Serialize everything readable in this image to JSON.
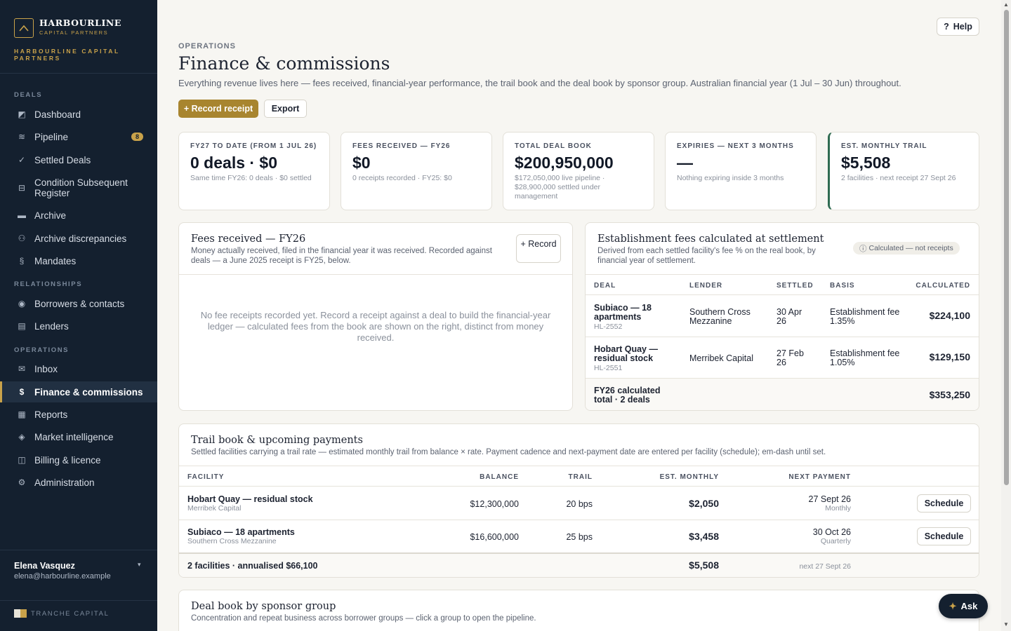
{
  "brand": {
    "name": "HARBOURLINE",
    "sub": "CAPITAL PARTNERS",
    "long": "HARBOURLINE CAPITAL PARTNERS"
  },
  "sidebar": {
    "sections": [
      {
        "label": "DEALS"
      },
      {
        "label": "RELATIONSHIPS"
      },
      {
        "label": "OPERATIONS"
      }
    ],
    "items": [
      {
        "label": "Dashboard",
        "icon": "dashboard-icon"
      },
      {
        "label": "Pipeline",
        "icon": "pipeline-icon",
        "badge": "8"
      },
      {
        "label": "Settled Deals",
        "icon": "check-icon"
      },
      {
        "label": "Condition Subsequent Register",
        "icon": "register-icon"
      },
      {
        "label": "Archive",
        "icon": "archive-icon"
      },
      {
        "label": "Archive discrepancies",
        "icon": "discrepancies-icon"
      },
      {
        "label": "Mandates",
        "icon": "mandates-icon"
      },
      {
        "label": "Borrowers & contacts",
        "icon": "contacts-icon"
      },
      {
        "label": "Lenders",
        "icon": "lenders-icon"
      },
      {
        "label": "Inbox",
        "icon": "inbox-icon"
      },
      {
        "label": "Finance & commissions",
        "icon": "dollar-icon"
      },
      {
        "label": "Reports",
        "icon": "reports-icon"
      },
      {
        "label": "Market intelligence",
        "icon": "market-icon"
      },
      {
        "label": "Billing & licence",
        "icon": "billing-icon"
      },
      {
        "label": "Administration",
        "icon": "gear-icon"
      }
    ],
    "user": {
      "name": "Elena Vasquez",
      "email": "elena@harbourline.example"
    },
    "footer": "TRANCHE CAPITAL"
  },
  "header": {
    "help": "Help",
    "eyebrow": "OPERATIONS",
    "title": "Finance & commissions",
    "subtitle": "Everything revenue lives here — fees received, financial-year performance, the trail book and the deal book by sponsor group. Australian financial year (1 Jul – 30 Jun) throughout.",
    "primary_btn": "+ Record receipt",
    "secondary_btn": "Export"
  },
  "kpis": [
    {
      "label": "FY27 TO DATE (FROM 1 JUL 26)",
      "value": "0 deals · $0",
      "note": "Same time FY26: 0 deals · $0 settled"
    },
    {
      "label": "FEES RECEIVED — FY26",
      "value": "$0",
      "note": "0 receipts recorded · FY25: $0"
    },
    {
      "label": "TOTAL DEAL BOOK",
      "value": "$200,950,000",
      "note": "$172,050,000 live pipeline · $28,900,000 settled under management"
    },
    {
      "label": "EXPIRIES — NEXT 3 MONTHS",
      "value": "—",
      "note": "Nothing expiring inside 3 months"
    },
    {
      "label": "EST. MONTHLY TRAIL",
      "value": "$5,508",
      "note": "2 facilities · next receipt 27 Sept 26"
    }
  ],
  "fees": {
    "title": "Fees received — FY26",
    "desc": "Money actually received, filed in the financial year it was received. Recorded against deals — a June 2025 receipt is FY25, below.",
    "record_btn": "+ Record",
    "empty": "No fee receipts recorded yet. Record a receipt against a deal to build the financial-year ledger — calculated fees from the book are shown on the right, distinct from money received."
  },
  "establishment": {
    "title": "Establishment fees calculated at settlement",
    "desc": "Derived from each settled facility's fee % on the real book, by financial year of settlement.",
    "chip": "Calculated — not receipts",
    "columns": [
      "DEAL",
      "LENDER",
      "SETTLED",
      "BASIS",
      "CALCULATED"
    ],
    "rows": [
      {
        "deal": "Subiaco — 18 apartments",
        "code": "HL-2552",
        "lender": "Southern Cross Mezzanine",
        "settled": "30 Apr 26",
        "basis": "Establishment fee 1.35%",
        "calculated": "$224,100"
      },
      {
        "deal": "Hobart Quay — residual stock",
        "code": "HL-2551",
        "lender": "Merribek Capital",
        "settled": "27 Feb 26",
        "basis": "Establishment fee 1.05%",
        "calculated": "$129,150"
      }
    ],
    "total_label": "FY26 calculated total · 2 deals",
    "total_value": "$353,250"
  },
  "trail": {
    "title": "Trail book & upcoming payments",
    "desc": "Settled facilities carrying a trail rate — estimated monthly trail from balance × rate. Payment cadence and next-payment date are entered per facility (schedule); em-dash until set.",
    "columns": [
      "FACILITY",
      "BALANCE",
      "TRAIL",
      "EST. MONTHLY",
      "NEXT PAYMENT"
    ],
    "rows": [
      {
        "facility": "Hobart Quay — residual stock",
        "lender": "Merribek Capital",
        "balance": "$12,300,000",
        "trail": "20 bps",
        "monthly": "$2,050",
        "next": "27 Sept 26",
        "cadence": "Monthly",
        "action": "Schedule"
      },
      {
        "facility": "Subiaco — 18 apartments",
        "lender": "Southern Cross Mezzanine",
        "balance": "$16,600,000",
        "trail": "25 bps",
        "monthly": "$3,458",
        "next": "30 Oct 26",
        "cadence": "Quarterly",
        "action": "Schedule"
      }
    ],
    "footer_label": "2 facilities · annualised $66,100",
    "footer_monthly": "$5,508",
    "footer_next": "next 27 Sept 26"
  },
  "dealbook": {
    "title": "Deal book by sponsor group",
    "desc": "Concentration and repeat business across borrower groups — click a group to open the pipeline."
  },
  "ask": "Ask",
  "colors": {
    "sidebar": "#14202f",
    "gold": "#c9a24a",
    "primary_btn": "#a8852f",
    "trail_accent": "#2f6b52",
    "background": "#f7f6f2"
  }
}
